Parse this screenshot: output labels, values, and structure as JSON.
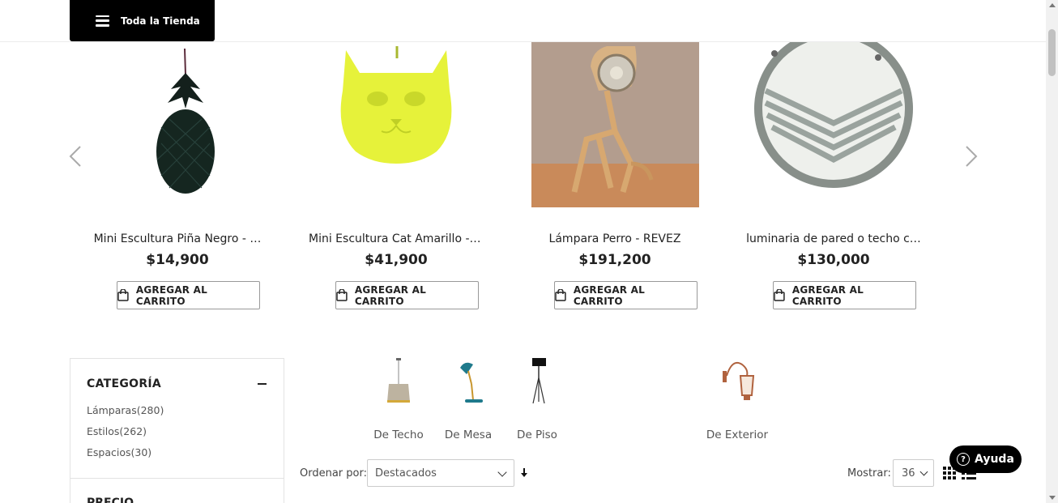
{
  "header": {
    "store_button_label": "Toda la Tienda"
  },
  "products": [
    {
      "name": "Mini Escultura Piña Negro - …",
      "price": "$14,900",
      "cart_label": "AGREGAR AL CARRITO"
    },
    {
      "name": "Mini Escultura Cat Amarillo - …",
      "price": "$41,900",
      "cart_label": "AGREGAR AL CARRITO"
    },
    {
      "name": "Lámpara Perro - REVEZ",
      "price": "$191,200",
      "cart_label": "AGREGAR AL CARRITO"
    },
    {
      "name": "luminaria de pared o techo c…",
      "price": "$130,000",
      "cart_label": "AGREGAR AL CARRITO"
    }
  ],
  "sidebar": {
    "category_title": "CATEGORÍA",
    "categories": [
      {
        "label": "Lámparas(280)"
      },
      {
        "label": "Estilos(262)"
      },
      {
        "label": "Espacios(30)"
      }
    ],
    "price_title": "PRECIO"
  },
  "category_nav": [
    {
      "label": "De Techo",
      "icon": "pendant-lamp-icon"
    },
    {
      "label": "De Mesa",
      "icon": "desk-lamp-icon"
    },
    {
      "label": "De Piso",
      "icon": "floor-lamp-icon"
    },
    {
      "label": "De Exterior",
      "icon": "wall-lantern-icon"
    }
  ],
  "toolbar": {
    "sort_label": "Ordenar por:",
    "sort_value": "Destacados",
    "show_label": "Mostrar:",
    "show_value": "36"
  },
  "help": {
    "label": "Ayuda"
  },
  "colors": {
    "dark": "#000000",
    "text": "#222222",
    "muted": "#555555",
    "border": "#e3e3e3"
  }
}
